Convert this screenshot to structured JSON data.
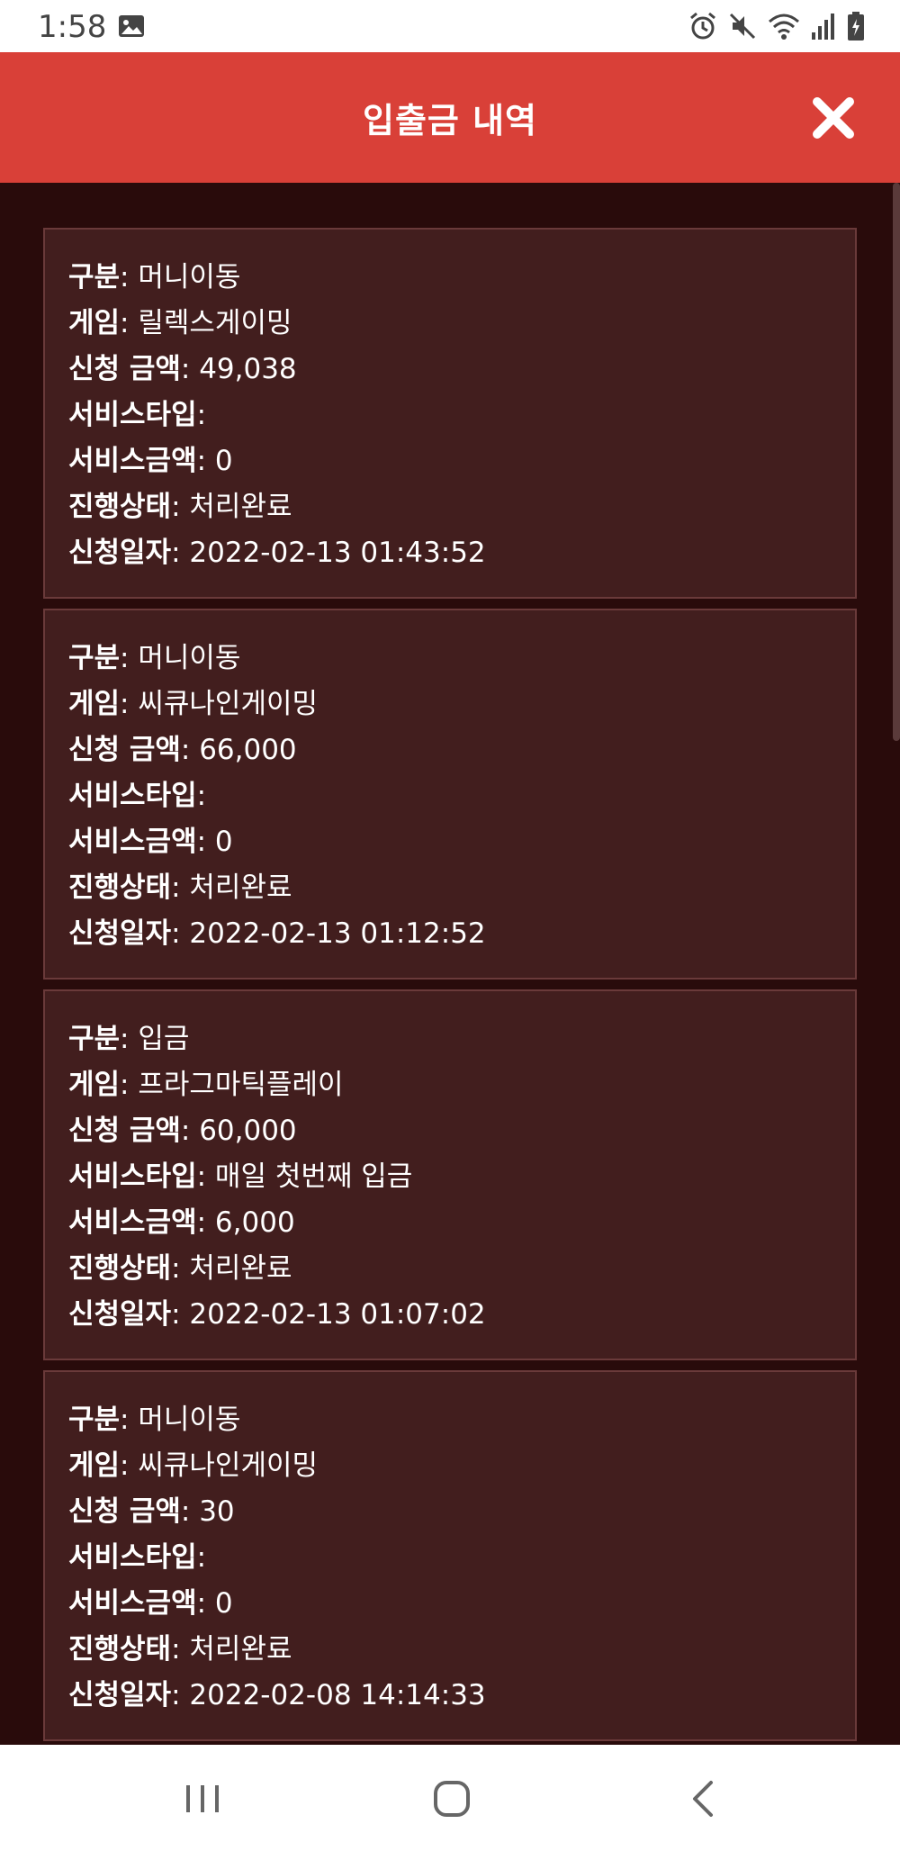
{
  "status_bar": {
    "time": "1:58",
    "icons": [
      "image-icon",
      "alarm-icon",
      "mute-icon",
      "wifi-icon",
      "signal-icon",
      "battery-icon"
    ]
  },
  "header": {
    "title": "입출금 내역",
    "close_icon": "close-icon",
    "background": "#d94038"
  },
  "colors": {
    "content_bg": "#290b0b",
    "card_bg": "#421e1e",
    "card_border": "#6a3a3a"
  },
  "labels": {
    "type": "구분",
    "game": "게임",
    "amount": "신청 금액",
    "service_type": "서비스타입",
    "service_amount": "서비스금액",
    "status": "진행상태",
    "date": "신청일자"
  },
  "records": [
    {
      "type": "머니이동",
      "game": "릴렉스게이밍",
      "amount": "49,038",
      "service_type": "",
      "service_amount": "0",
      "status": "처리완료",
      "date": "2022-02-13 01:43:52"
    },
    {
      "type": "머니이동",
      "game": "씨큐나인게이밍",
      "amount": "66,000",
      "service_type": "",
      "service_amount": "0",
      "status": "처리완료",
      "date": "2022-02-13 01:12:52"
    },
    {
      "type": "입금",
      "game": "프라그마틱플레이",
      "amount": "60,000",
      "service_type": "매일 첫번째 입금",
      "service_amount": "6,000",
      "status": "처리완료",
      "date": "2022-02-13 01:07:02"
    },
    {
      "type": "머니이동",
      "game": "씨큐나인게이밍",
      "amount": "30",
      "service_type": "",
      "service_amount": "0",
      "status": "처리완료",
      "date": "2022-02-08 14:14:33"
    }
  ],
  "nav_bar": {
    "buttons": [
      "recent-apps-icon",
      "home-icon",
      "back-icon"
    ]
  }
}
